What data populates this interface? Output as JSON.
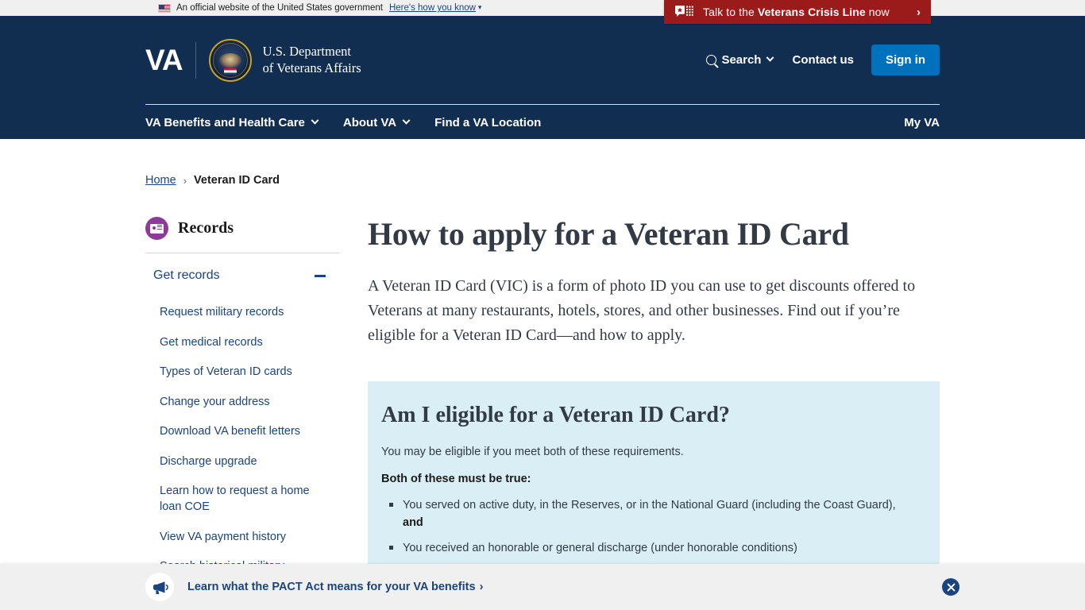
{
  "gov_banner": {
    "text": "An official website of the United States government",
    "link_label": "Here's how you know",
    "flag_icon": "us-flag-icon",
    "chevron_icon": "chevron-down-icon"
  },
  "crisis_banner": {
    "prefix": "Talk to the ",
    "bold": "Veterans Crisis Line",
    "suffix": " now",
    "icon": "crisis-chat-icon",
    "arrow": "›",
    "background": "#9b1b1b"
  },
  "header": {
    "logo_va": "VA",
    "logo_line1": "U.S. Department",
    "logo_line2": "of Veterans Affairs",
    "seal_icon": "va-seal-icon",
    "search_label": "Search",
    "search_icon": "search-icon",
    "contact_label": "Contact us",
    "signin_label": "Sign in",
    "myva_label": "My VA",
    "background": "#112e51",
    "signin_color": "#0071bc",
    "nav_items": [
      {
        "label": "VA Benefits and Health Care",
        "has_chevron": true
      },
      {
        "label": "About VA",
        "has_chevron": true
      },
      {
        "label": "Find a VA Location",
        "has_chevron": false
      }
    ]
  },
  "breadcrumb": {
    "home": "Home",
    "separator": "›",
    "current": "Veteran ID Card"
  },
  "sidebar": {
    "section_icon": "records-id-card-icon",
    "section_icon_color": "#8e3a99",
    "section_title": "Records",
    "group_label": "Get records",
    "collapse_icon": "minus-icon",
    "items": [
      {
        "label": "Request military records"
      },
      {
        "label": "Get medical records"
      },
      {
        "label": "Types of Veteran ID cards"
      },
      {
        "label": "Change your address"
      },
      {
        "label": "Download VA benefit letters"
      },
      {
        "label": "Discharge upgrade"
      },
      {
        "label": "Learn how to request a home loan COE"
      },
      {
        "label": "View VA payment history"
      },
      {
        "label": "Search historical military"
      }
    ]
  },
  "main": {
    "title": "How to apply for a Veteran ID Card",
    "intro": "A Veteran ID Card (VIC) is a form of photo ID you can use to get discounts offered to Veterans at many restaurants, hotels, stores, and other businesses. Find out if you’re eligible for a Veteran ID Card—and how to apply.",
    "eligibility": {
      "title": "Am I eligible for a Veteran ID Card?",
      "subtitle": "You may be eligible if you meet both of these requirements.",
      "requirement_label": "Both of these must be true:",
      "bullets": [
        {
          "text": "You served on active duty, in the Reserves, or in the National Guard (including the Coast Guard),",
          "suffix_bold": "and"
        },
        {
          "text": "You received an honorable or general discharge (under honorable conditions)",
          "suffix_bold": ""
        }
      ],
      "background": "#d9eef5"
    }
  },
  "pact_banner": {
    "icon": "megaphone-icon",
    "text": "Learn what the PACT Act means for your VA benefits",
    "arrow": "›",
    "close_icon": "close-icon",
    "close_color": "#1a4480"
  }
}
